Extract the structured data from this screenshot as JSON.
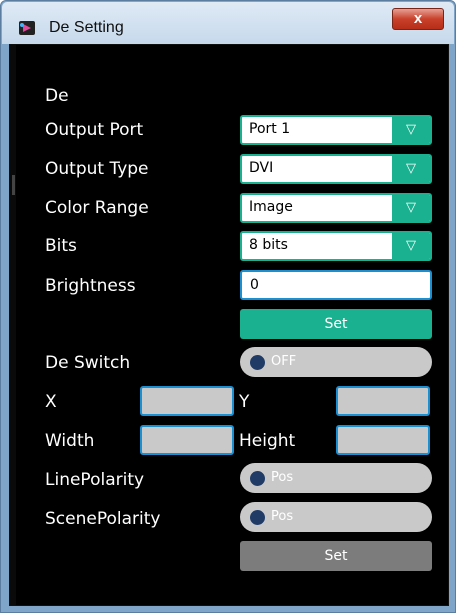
{
  "window": {
    "title": "De Setting",
    "close_glyph": "x",
    "icon": "app-logo-icon"
  },
  "section": {
    "heading": "De"
  },
  "output_port": {
    "label": "Output Port",
    "value": "Port 1"
  },
  "output_type": {
    "label": "Output Type",
    "value": "DVI"
  },
  "color_range": {
    "label": "Color Range",
    "value": "Image"
  },
  "bits": {
    "label": "Bits",
    "value": "8 bits"
  },
  "brightness": {
    "label": "Brightness",
    "value": "0"
  },
  "dropdown_glyph": "▽",
  "set_button_1": {
    "label": "Set"
  },
  "de_switch": {
    "label": "De Switch",
    "state": "OFF"
  },
  "x_field": {
    "label": "X",
    "value": ""
  },
  "y_field": {
    "label": "Y",
    "value": ""
  },
  "width_field": {
    "label": "Width",
    "value": ""
  },
  "height_field": {
    "label": "Height",
    "value": ""
  },
  "line_polarity": {
    "label": "LinePolarity",
    "state": "Pos"
  },
  "scene_polarity": {
    "label": "ScenePolarity",
    "state": "Pos"
  },
  "set_button_2": {
    "label": "Set"
  },
  "colors": {
    "accent": "#1ab190",
    "input_border": "#1a8fd1",
    "panel_bg": "#000000",
    "toggle_bg": "#c9c9c9",
    "knob": "#1f3b66"
  }
}
